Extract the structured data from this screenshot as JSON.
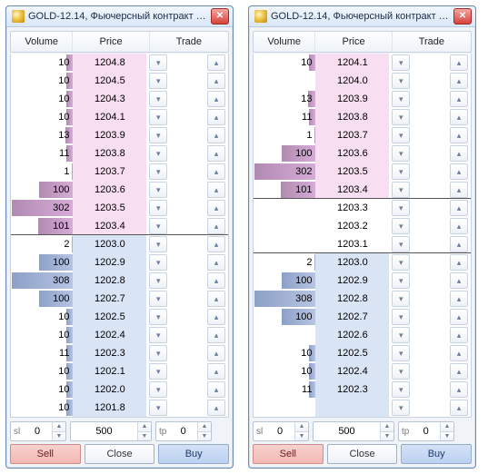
{
  "windows": [
    {
      "title": "GOLD-12.14, Фьючерсный контракт G…",
      "headers": {
        "vol": "Volume",
        "price": "Price",
        "trade": "Trade"
      },
      "inputs": {
        "sl_label": "sl",
        "sl_value": "0",
        "qty_value": "500",
        "tp_label": "tp",
        "tp_value": "0"
      },
      "actions": {
        "sell": "Sell",
        "close": "Close",
        "buy": "Buy"
      },
      "best_ask_index": 9,
      "best_bid_index": 10,
      "rows": [
        {
          "vol": "10",
          "price": "1204.8",
          "side": "ask",
          "bar": 0.1
        },
        {
          "vol": "10",
          "price": "1204.5",
          "side": "ask",
          "bar": 0.1
        },
        {
          "vol": "10",
          "price": "1204.3",
          "side": "ask",
          "bar": 0.1
        },
        {
          "vol": "10",
          "price": "1204.1",
          "side": "ask",
          "bar": 0.1
        },
        {
          "vol": "13",
          "price": "1203.9",
          "side": "ask",
          "bar": 0.12
        },
        {
          "vol": "11",
          "price": "1203.8",
          "side": "ask",
          "bar": 0.11
        },
        {
          "vol": "1",
          "price": "1203.7",
          "side": "ask",
          "bar": 0.02
        },
        {
          "vol": "100",
          "price": "1203.6",
          "side": "ask",
          "bar": 0.55
        },
        {
          "vol": "302",
          "price": "1203.5",
          "side": "ask",
          "bar": 1.0
        },
        {
          "vol": "101",
          "price": "1203.4",
          "side": "ask",
          "bar": 0.56
        },
        {
          "vol": "2",
          "price": "1203.0",
          "side": "bid",
          "bar": 0.02
        },
        {
          "vol": "100",
          "price": "1202.9",
          "side": "bid",
          "bar": 0.55
        },
        {
          "vol": "308",
          "price": "1202.8",
          "side": "bid",
          "bar": 1.0
        },
        {
          "vol": "100",
          "price": "1202.7",
          "side": "bid",
          "bar": 0.55
        },
        {
          "vol": "10",
          "price": "1202.5",
          "side": "bid",
          "bar": 0.1
        },
        {
          "vol": "10",
          "price": "1202.4",
          "side": "bid",
          "bar": 0.1
        },
        {
          "vol": "11",
          "price": "1202.3",
          "side": "bid",
          "bar": 0.11
        },
        {
          "vol": "10",
          "price": "1202.1",
          "side": "bid",
          "bar": 0.1
        },
        {
          "vol": "10",
          "price": "1202.0",
          "side": "bid",
          "bar": 0.1
        },
        {
          "vol": "10",
          "price": "1201.8",
          "side": "bid",
          "bar": 0.1
        }
      ]
    },
    {
      "title": "GOLD-12.14, Фьючерсный контракт G…",
      "headers": {
        "vol": "Volume",
        "price": "Price",
        "trade": "Trade"
      },
      "inputs": {
        "sl_label": "sl",
        "sl_value": "0",
        "qty_value": "500",
        "tp_label": "tp",
        "tp_value": "0"
      },
      "actions": {
        "sell": "Sell",
        "close": "Close",
        "buy": "Buy"
      },
      "best_ask_index": 7,
      "best_bid_index": 11,
      "rows": [
        {
          "vol": "10",
          "price": "1204.1",
          "side": "ask",
          "bar": 0.1
        },
        {
          "vol": "",
          "price": "1204.0",
          "side": "ask",
          "bar": 0.0
        },
        {
          "vol": "13",
          "price": "1203.9",
          "side": "ask",
          "bar": 0.12
        },
        {
          "vol": "11",
          "price": "1203.8",
          "side": "ask",
          "bar": 0.11
        },
        {
          "vol": "1",
          "price": "1203.7",
          "side": "ask",
          "bar": 0.02
        },
        {
          "vol": "100",
          "price": "1203.6",
          "side": "ask",
          "bar": 0.55
        },
        {
          "vol": "302",
          "price": "1203.5",
          "side": "ask",
          "bar": 1.0
        },
        {
          "vol": "101",
          "price": "1203.4",
          "side": "ask",
          "bar": 0.56
        },
        {
          "vol": "",
          "price": "1203.3",
          "side": "gap",
          "bar": 0.0
        },
        {
          "vol": "",
          "price": "1203.2",
          "side": "gap",
          "bar": 0.0
        },
        {
          "vol": "",
          "price": "1203.1",
          "side": "gap",
          "bar": 0.0
        },
        {
          "vol": "2",
          "price": "1203.0",
          "side": "bid",
          "bar": 0.02
        },
        {
          "vol": "100",
          "price": "1202.9",
          "side": "bid",
          "bar": 0.55
        },
        {
          "vol": "308",
          "price": "1202.8",
          "side": "bid",
          "bar": 1.0
        },
        {
          "vol": "100",
          "price": "1202.7",
          "side": "bid",
          "bar": 0.55
        },
        {
          "vol": "",
          "price": "1202.6",
          "side": "bid",
          "bar": 0.0
        },
        {
          "vol": "10",
          "price": "1202.5",
          "side": "bid",
          "bar": 0.1
        },
        {
          "vol": "10",
          "price": "1202.4",
          "side": "bid",
          "bar": 0.1
        },
        {
          "vol": "11",
          "price": "1202.3",
          "side": "bid",
          "bar": 0.11
        },
        {
          "vol": "",
          "price": "",
          "side": "bid",
          "bar": 0.0
        }
      ]
    }
  ]
}
